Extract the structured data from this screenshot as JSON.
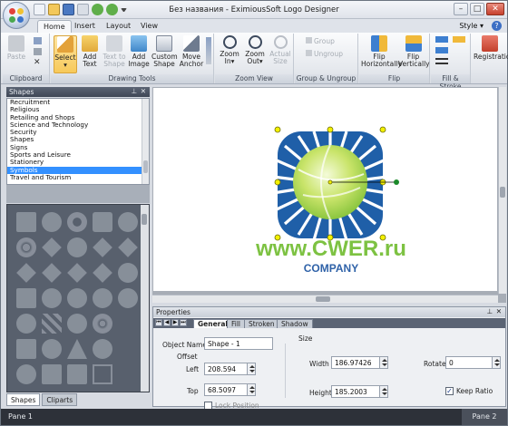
{
  "window": {
    "title": "Без названия - EximiousSoft Logo Designer"
  },
  "menu": {
    "tabs": [
      "Home",
      "Insert",
      "Layout",
      "View"
    ],
    "active_tab": "Home",
    "style_label": "Style",
    "help": "?"
  },
  "window_controls": {
    "minimize": "–",
    "maximize": "□",
    "close": "✕"
  },
  "ribbon": {
    "clipboard": {
      "label": "Clipboard",
      "paste": "Paste"
    },
    "drawing_tools": {
      "label": "Drawing Tools",
      "select": "Select",
      "add_text": "Add\nText",
      "text_to_shape": "Text to\nShape",
      "add_image": "Add\nImage",
      "custom_shape": "Custom\nShape",
      "move_anchor": "Move\nAnchor"
    },
    "zoom_view": {
      "label": "Zoom View",
      "zoom_in": "Zoom\nIn",
      "zoom_out": "Zoom\nOut",
      "actual_size": "Actual\nSize"
    },
    "group_ungroup": {
      "label": "Group & Ungroup",
      "group": "Group",
      "ungroup": "Ungroup"
    },
    "flip": {
      "label": "Flip",
      "flip_h": "Flip\nHorizontally",
      "flip_v": "Flip\nVertically"
    },
    "fill_stroke": {
      "label": "Fill & Stroke"
    },
    "registration": {
      "label": "Registratio"
    }
  },
  "shapes_panel": {
    "title": "Shapes",
    "categories": [
      "Recruitment",
      "Religious",
      "Retailing and Shops",
      "Science and Technology",
      "Security",
      "Shapes",
      "Signs",
      "Sports and Leisure",
      "Stationery",
      "Symbols",
      "Travel and Tourism"
    ],
    "selected": "Symbols",
    "bottom_tabs": [
      "Shapes",
      "Cliparts"
    ],
    "active_bottom_tab": "Shapes"
  },
  "canvas": {
    "logo_text": "www.CWER.ru",
    "logo_subtext": "COMPANY",
    "colors": {
      "blue": "#1f5fa8",
      "green": "#8cc63f",
      "text_green": "#7dc242",
      "text_blue": "#2f62a8"
    }
  },
  "properties": {
    "title": "Properties",
    "tabs": [
      "General",
      "Fill",
      "Stroken",
      "Shadow"
    ],
    "active_tab": "General",
    "object_name_label": "Object Name",
    "object_name": "Shape - 1",
    "offset_label": "Offset",
    "left_label": "Left",
    "left": "208.594",
    "top_label": "Top",
    "top": "68.5097",
    "lock_position": "Lock Position",
    "size_label": "Size",
    "width_label": "Width",
    "width": "186.97426",
    "height_label": "Height",
    "height": "185.2003",
    "rotate_label": "Rotate",
    "rotate": "0",
    "keep_ratio": "Keep Ratio",
    "keep_ratio_checked": "✓"
  },
  "status": {
    "pane1": "Pane 1",
    "pane2": "Pane 2"
  }
}
